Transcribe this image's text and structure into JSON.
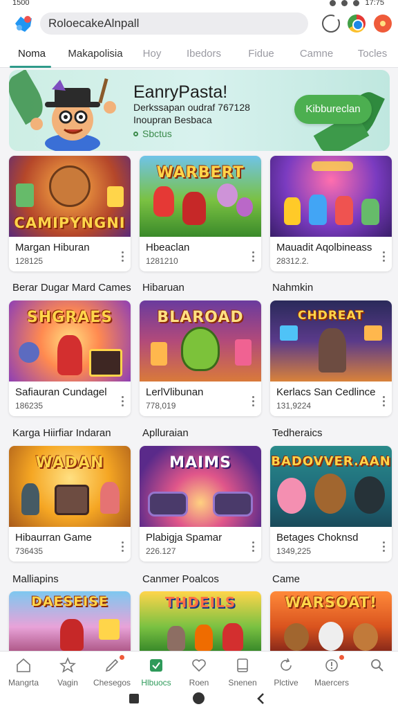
{
  "status_bar": {
    "time": "1500",
    "clock": "17:75"
  },
  "search": {
    "value": "RoloecakeAlnpall"
  },
  "tabs": [
    {
      "label": "Noma",
      "active": true
    },
    {
      "label": "Makapolisia"
    },
    {
      "label": "Hoy"
    },
    {
      "label": "Ibedors"
    },
    {
      "label": "Fidue"
    },
    {
      "label": "Camne"
    },
    {
      "label": "Tocles"
    }
  ],
  "banner": {
    "title": "EanryPasta!",
    "line1": "Derkssapan oudraf 767128",
    "line2": "Inoupran Besbaca",
    "status": "Sbctus",
    "button": "Kibbureclan"
  },
  "cards": [
    {
      "name": "Margan Hiburan",
      "count": "128125",
      "art": "CAMIPYNGNI"
    },
    {
      "name": "Hbeaclan",
      "count": "1281210",
      "art": "WARBERT"
    },
    {
      "name": "Mauadit Aqolbineass",
      "count": "28312.2.",
      "art": ""
    },
    {
      "name": "Safiauran Cundagel",
      "count": "186235",
      "art": "SHGRAES"
    },
    {
      "name": "LerlVlibunan",
      "count": "778,019",
      "art": "BLAROAD"
    },
    {
      "name": "Kerlacs San Cedlince",
      "count": "131,9224",
      "art": "CHDREAT"
    },
    {
      "name": "Hibaurran Game",
      "count": "736435",
      "art": "WADAN"
    },
    {
      "name": "Plabigja Spamar",
      "count": "226.127",
      "art": "MAIMS"
    },
    {
      "name": "Betages Choknsd",
      "count": "1349,225",
      "art": "BADOVVER.AAN"
    },
    {
      "name": "",
      "count": "",
      "art": "DAESEISE"
    },
    {
      "name": "",
      "count": "",
      "art": "THDEILS"
    },
    {
      "name": "",
      "count": "",
      "art": "WARSOAT!"
    }
  ],
  "sections": [
    "Berar Dugar Mard Cames",
    "Hibaruan",
    "Nahmkin",
    "Karga Hiirfiar Indaran",
    "Aplluraian",
    "Tedheraics",
    "Malliapins",
    "Canmer Poalcos",
    "Came"
  ],
  "bottom_nav": [
    {
      "label": "Mangrta",
      "icon": "home-icon"
    },
    {
      "label": "Vagin",
      "icon": "star-icon"
    },
    {
      "label": "Chesegos",
      "icon": "edit-icon",
      "badge": true
    },
    {
      "label": "Hlbuocs",
      "icon": "check-box-icon",
      "active": true
    },
    {
      "label": "Roen",
      "icon": "heart-icon"
    },
    {
      "label": "Snenen",
      "icon": "tablet-icon"
    },
    {
      "label": "Plctive",
      "icon": "refresh-icon"
    },
    {
      "label": "Maercers",
      "icon": "alert-icon",
      "badge": true
    },
    {
      "label": "",
      "icon": "search-icon"
    }
  ],
  "colors": {
    "accent": "#2e9a8a",
    "banner_button": "#4caf50",
    "active_nav": "#2e9a5a"
  }
}
